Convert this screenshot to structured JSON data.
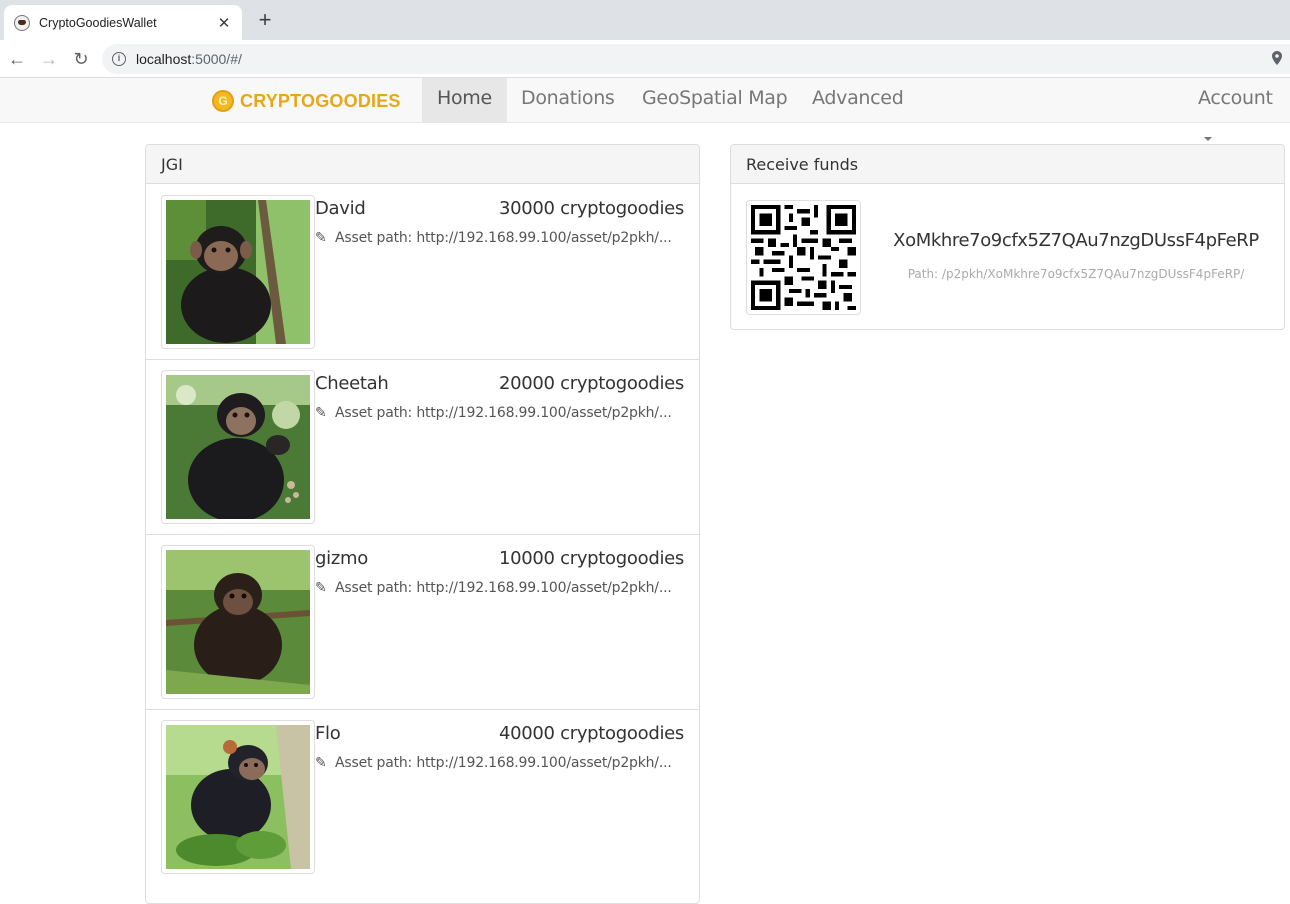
{
  "browser": {
    "tab_title": "CryptoGoodiesWallet",
    "url_host": "localhost",
    "url_rest": ":5000/#/"
  },
  "navbar": {
    "brand": "CRYPTOGOODIES",
    "items": [
      {
        "label": "Home",
        "active": true
      },
      {
        "label": "Donations"
      },
      {
        "label": "GeoSpatial Map"
      },
      {
        "label": "Advanced"
      }
    ],
    "account": "Account"
  },
  "assets_panel": {
    "title": "JGI",
    "items": [
      {
        "name": "David",
        "amount": "30000 cryptogoodies",
        "path": "Asset path: http://192.168.99.100/asset/p2pkh/..."
      },
      {
        "name": "Cheetah",
        "amount": "20000 cryptogoodies",
        "path": "Asset path: http://192.168.99.100/asset/p2pkh/..."
      },
      {
        "name": "gizmo",
        "amount": "10000 cryptogoodies",
        "path": "Asset path: http://192.168.99.100/asset/p2pkh/..."
      },
      {
        "name": "Flo",
        "amount": "40000 cryptogoodies",
        "path": "Asset path: http://192.168.99.100/asset/p2pkh/..."
      }
    ]
  },
  "receive_panel": {
    "title": "Receive funds",
    "address": "XoMkhre7o9cfx5Z7QAu7nzgDUssF4pFeRP",
    "path": "Path: /p2pkh/XoMkhre7o9cfx5Z7QAu7nzgDUssF4pFeRP/"
  },
  "icons": {
    "edit": "edit-icon",
    "info": "info-icon",
    "location": "location-pin-icon"
  },
  "colors": {
    "brand": "#e6a817",
    "nav_active_bg": "#e7e7e7"
  }
}
